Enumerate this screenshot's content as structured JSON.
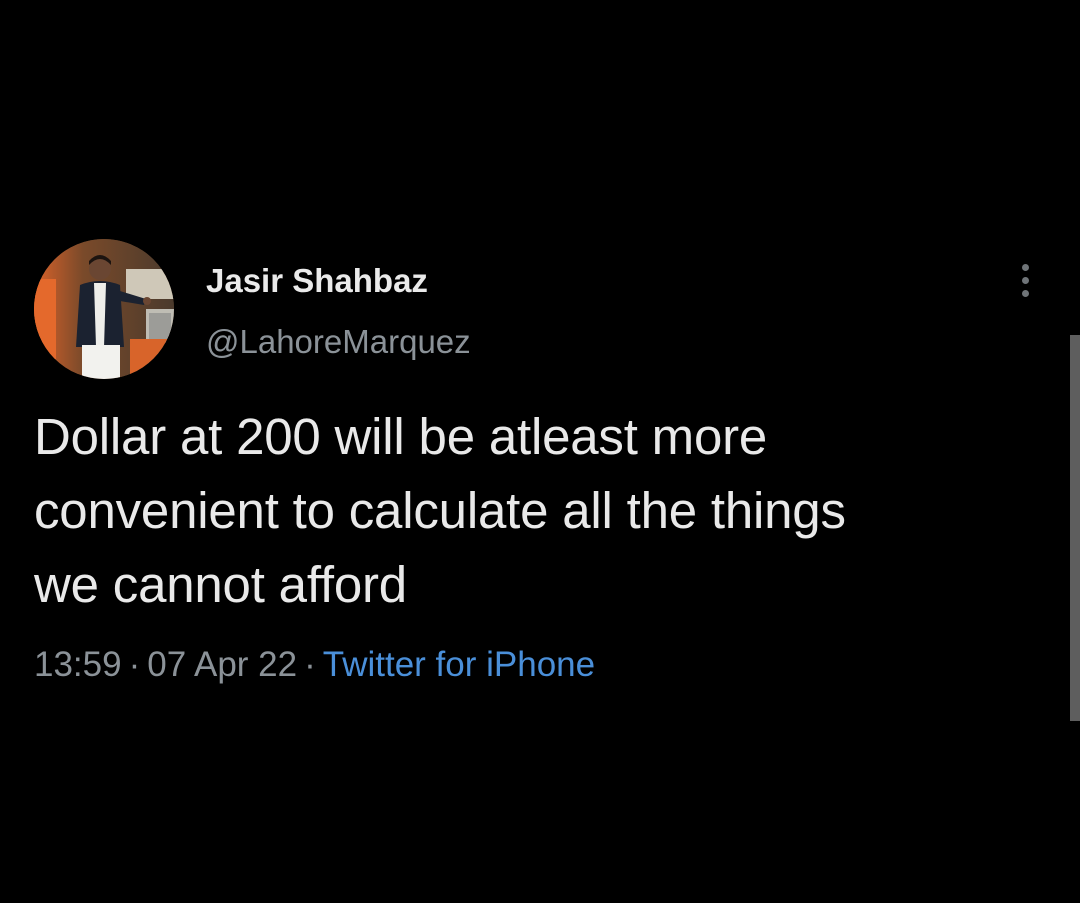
{
  "tweet": {
    "author": {
      "display_name": "Jasir Shahbaz",
      "handle": "@LahoreMarquez",
      "avatar_icon": "profile-photo-man-speaking"
    },
    "text_lines": [
      "Dollar at 200 will be atleast more",
      "convenient to calculate all the things",
      "we cannot afford"
    ],
    "time": "13:59",
    "separator": "·",
    "date": "07 Apr 22",
    "source": "Twitter for iPhone",
    "more_icon": "more-vertical-icon"
  },
  "colors": {
    "background": "#000000",
    "primary_text": "#e9e9e9",
    "secondary_text": "#8b9298",
    "link": "#4a8fd9"
  }
}
